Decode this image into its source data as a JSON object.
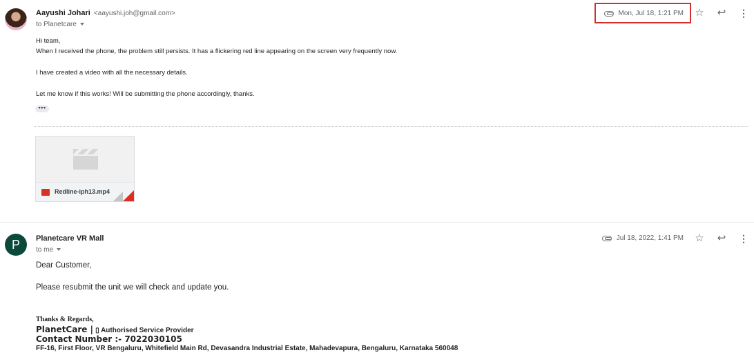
{
  "message1": {
    "sender_name": "Aayushi Johari",
    "sender_email": "<aayushi.joh@gmail.com>",
    "to_line": "to Planetcare",
    "date": "Mon, Jul 18, 1:21 PM",
    "body_lines": [
      "Hi team,",
      "When I received the phone, the problem still persists. It has a flickering red line appearing on the screen very frequently now.",
      "I have created a video with all the necessary details.",
      "Let me know if this works! Will be submitting the phone accordingly, thanks."
    ],
    "show_trimmed_label": "•••",
    "attachment": {
      "file_name": "Redline-iph13.mp4",
      "icon": "film-icon"
    }
  },
  "message2": {
    "avatar_letter": "P",
    "sender_name": "Planetcare VR Mall",
    "to_line": "to me",
    "date": "Jul 18, 2022, 1:41 PM",
    "greeting": "Dear Customer,",
    "body": "Please resubmit the unit we will check and update you.",
    "signature": {
      "regards": "Thanks & Regards,",
      "brand": "PlanetCare |",
      "brand_sub": "▯ Authorised Service Provider",
      "contact": "Contact Number :- 7022030105",
      "address": "FF-16, First Floor, VR Bengaluru, Whitefield Main Rd, Devasandra Industrial Estate, Mahadevapura, Bengaluru, Karnataka 560048"
    }
  },
  "icons": {
    "attachment": "paperclip-icon",
    "star": "star-icon",
    "reply": "reply-icon",
    "more": "more-vert-icon"
  },
  "colors": {
    "highlight": "#d32f2f",
    "avatar_bg": "#0b4a3b",
    "video_icon": "#d93025"
  }
}
